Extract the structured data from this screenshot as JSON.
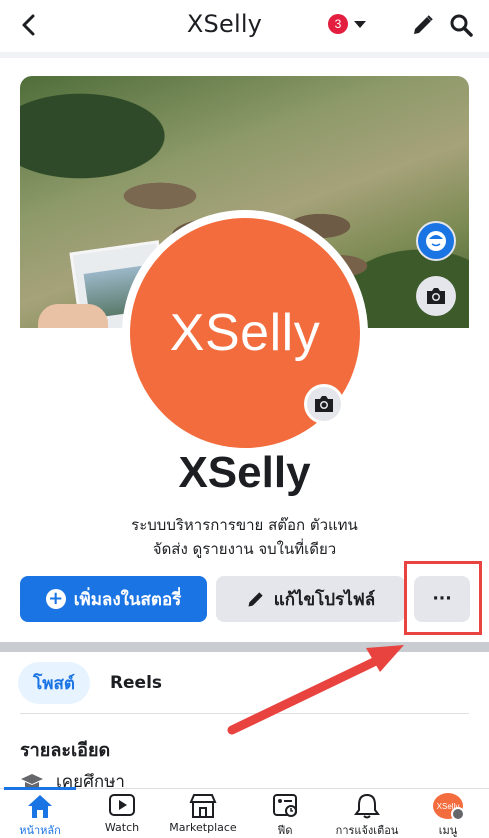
{
  "header": {
    "title": "XSelly",
    "badge_count": "3"
  },
  "profile": {
    "picture_text": "XSelly",
    "name": "XSelly",
    "bio_line1": "ระบบบริหารการขาย สต๊อก ตัวแทน",
    "bio_line2": "จัดส่ง ดูรายงาน จบในที่เดียว"
  },
  "actions": {
    "add_story_label": "เพิ่มลงในสตอรี่",
    "edit_profile_label": "แก้ไขโปรไฟล์",
    "more_label": "···"
  },
  "tabs": [
    {
      "label": "โพสต์",
      "active": true
    },
    {
      "label": "Reels",
      "active": false
    }
  ],
  "details": {
    "title": "รายละเอียด",
    "education": "เคยศึกษา"
  },
  "bottom_nav": [
    {
      "label": "หน้าหลัก",
      "icon": "home-icon",
      "active": true
    },
    {
      "label": "Watch",
      "icon": "watch-icon"
    },
    {
      "label": "Marketplace",
      "icon": "marketplace-icon"
    },
    {
      "label": "ฟีด",
      "icon": "feed-icon"
    },
    {
      "label": "การแจ้งเตือน",
      "icon": "bell-icon"
    },
    {
      "label": "เมนู",
      "icon": "menu-avatar",
      "avatar_text": "XSelly"
    }
  ],
  "colors": {
    "accent": "#1b74e4",
    "profile_bg": "#f36c3e",
    "highlight": "#e8433f",
    "badge": "#e41e3f"
  }
}
